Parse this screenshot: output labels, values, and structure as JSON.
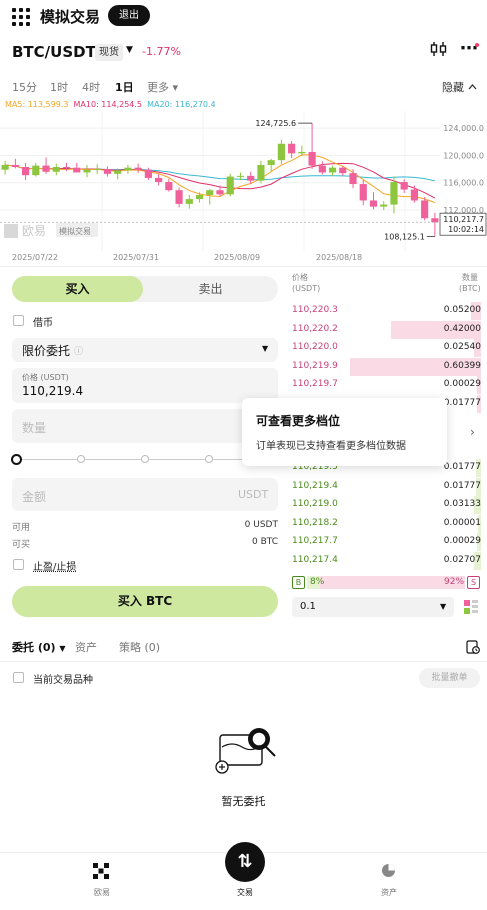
{
  "header": {
    "title": "模拟交易",
    "exit_label": "退出"
  },
  "ticker": {
    "pair": "BTC/USDT",
    "market_tag": "现货",
    "change": "-1.77%"
  },
  "timeframes": [
    {
      "label": "15分"
    },
    {
      "label": "1时"
    },
    {
      "label": "4时"
    },
    {
      "label": "1日",
      "active": true
    },
    {
      "label": "更多 ▾"
    }
  ],
  "hide_label": "隐藏",
  "ma": {
    "ma5": "MA5: 113,599.3",
    "ma10": "MA10: 114,254.5",
    "ma20": "MA20: 116,270.4",
    "ma5_color": "#f5a623",
    "ma10_color": "#e0306a",
    "ma20_color": "#3ab8d0"
  },
  "chart_data": {
    "type": "candlestick",
    "x": [
      "2025/07/22",
      "2025/07/31",
      "2025/08/09",
      "2025/08/18"
    ],
    "high_label": "124,725.6",
    "low_label": "108,125.1",
    "current_price": "110,217.7",
    "countdown": "10:02:14",
    "y_ticks": [
      "124,000.0",
      "120,000.0",
      "116,000.0",
      "112,000.0"
    ],
    "ylim": [
      106000,
      126500
    ],
    "watermark": "欧易",
    "watermark_tag": "模拟交易",
    "candles": [
      {
        "o": 117900,
        "h": 119200,
        "l": 117200,
        "c": 118600
      },
      {
        "o": 118600,
        "h": 119500,
        "l": 118100,
        "c": 118300
      },
      {
        "o": 118300,
        "h": 118900,
        "l": 116400,
        "c": 117100
      },
      {
        "o": 117100,
        "h": 118900,
        "l": 116900,
        "c": 118500
      },
      {
        "o": 118500,
        "h": 119700,
        "l": 117300,
        "c": 117600
      },
      {
        "o": 117600,
        "h": 118800,
        "l": 117100,
        "c": 118300
      },
      {
        "o": 118300,
        "h": 118900,
        "l": 117700,
        "c": 118200
      },
      {
        "o": 118200,
        "h": 118900,
        "l": 117500,
        "c": 117500
      },
      {
        "o": 117500,
        "h": 118600,
        "l": 116800,
        "c": 117900
      },
      {
        "o": 117900,
        "h": 118700,
        "l": 117300,
        "c": 118000
      },
      {
        "o": 118000,
        "h": 118400,
        "l": 116900,
        "c": 117300
      },
      {
        "o": 117300,
        "h": 118100,
        "l": 116500,
        "c": 117800
      },
      {
        "o": 117800,
        "h": 118600,
        "l": 117300,
        "c": 118200
      },
      {
        "o": 118200,
        "h": 118800,
        "l": 117400,
        "c": 117900
      },
      {
        "o": 117900,
        "h": 118200,
        "l": 116400,
        "c": 116700
      },
      {
        "o": 116700,
        "h": 117300,
        "l": 115600,
        "c": 116100
      },
      {
        "o": 116100,
        "h": 116600,
        "l": 114700,
        "c": 114900
      },
      {
        "o": 114900,
        "h": 115300,
        "l": 112400,
        "c": 112900
      },
      {
        "o": 112900,
        "h": 114200,
        "l": 112200,
        "c": 113600
      },
      {
        "o": 113600,
        "h": 114600,
        "l": 113100,
        "c": 114200
      },
      {
        "o": 114200,
        "h": 115100,
        "l": 112800,
        "c": 114900
      },
      {
        "o": 114900,
        "h": 115600,
        "l": 114000,
        "c": 114300
      },
      {
        "o": 114300,
        "h": 117300,
        "l": 114000,
        "c": 116900
      },
      {
        "o": 116900,
        "h": 117500,
        "l": 116400,
        "c": 117000
      },
      {
        "o": 117000,
        "h": 117600,
        "l": 115800,
        "c": 116300
      },
      {
        "o": 116300,
        "h": 119200,
        "l": 115900,
        "c": 118600
      },
      {
        "o": 118600,
        "h": 119500,
        "l": 117700,
        "c": 119300
      },
      {
        "o": 119300,
        "h": 122300,
        "l": 118700,
        "c": 121700
      },
      {
        "o": 121700,
        "h": 122100,
        "l": 119600,
        "c": 120300
      },
      {
        "o": 120300,
        "h": 121400,
        "l": 119900,
        "c": 120500
      },
      {
        "o": 120500,
        "h": 124725.6,
        "l": 118000,
        "c": 118500
      },
      {
        "o": 118500,
        "h": 119100,
        "l": 117200,
        "c": 117500
      },
      {
        "o": 117500,
        "h": 118500,
        "l": 117000,
        "c": 118200
      },
      {
        "o": 118200,
        "h": 118400,
        "l": 117000,
        "c": 117400
      },
      {
        "o": 117400,
        "h": 118000,
        "l": 115200,
        "c": 115800
      },
      {
        "o": 115800,
        "h": 116400,
        "l": 112700,
        "c": 113400
      },
      {
        "o": 113400,
        "h": 114600,
        "l": 112100,
        "c": 112500
      },
      {
        "o": 112500,
        "h": 113300,
        "l": 112000,
        "c": 112800
      },
      {
        "o": 112800,
        "h": 116900,
        "l": 111500,
        "c": 116100
      },
      {
        "o": 116100,
        "h": 116500,
        "l": 114500,
        "c": 115000
      },
      {
        "o": 115000,
        "h": 115600,
        "l": 113100,
        "c": 113400
      },
      {
        "o": 113400,
        "h": 113900,
        "l": 110500,
        "c": 110800
      },
      {
        "o": 110800,
        "h": 111600,
        "l": 108125.1,
        "c": 110217.7
      }
    ]
  },
  "order_form": {
    "buy_tab": "买入",
    "sell_tab": "卖出",
    "borrow_label": "借币",
    "order_type": "限价委托",
    "price_label": "价格 (USDT)",
    "price_value": "110,219.4",
    "qty_placeholder": "数量",
    "amount_placeholder": "金额",
    "amount_unit": "USDT",
    "available_label": "可用",
    "available_value": "0 USDT",
    "can_buy_label": "可买",
    "can_buy_value": "0 BTC",
    "tp_sl_label": "止盈/止损",
    "buy_button": "买入 BTC",
    "slider_percent": 0
  },
  "orderbook": {
    "price_head": "价格",
    "price_unit": "(USDT)",
    "qty_head": "数量",
    "qty_unit": "(BTC)",
    "asks": [
      {
        "price": "110,220.3",
        "qty": "0.05200",
        "depth": 0.08
      },
      {
        "price": "110,220.2",
        "qty": "0.42000",
        "depth": 0.69
      },
      {
        "price": "110,220.0",
        "qty": "0.02540",
        "depth": 0.05
      },
      {
        "price": "110,219.9",
        "qty": "0.60399",
        "depth": 1.0
      },
      {
        "price": "110,219.7",
        "qty": "0.00029",
        "depth": 0.03
      }
    ],
    "ask_partial": {
      "qty": "0.01777"
    },
    "bids": [
      {
        "price": "110,219.5",
        "qty": "0.01777",
        "depth": 0.04
      },
      {
        "price": "110,219.4",
        "qty": "0.01777",
        "depth": 0.04
      },
      {
        "price": "110,219.0",
        "qty": "0.03133",
        "depth": 0.05
      },
      {
        "price": "110,218.2",
        "qty": "0.00001",
        "depth": 0.02
      },
      {
        "price": "110,217.7",
        "qty": "0.00029",
        "depth": 0.03
      },
      {
        "price": "110,217.4",
        "qty": "0.02707",
        "depth": 0.05
      }
    ],
    "ratio_buy_label": "B",
    "ratio_buy": "8%",
    "ratio_sell": "92%",
    "ratio_sell_label": "S",
    "buy_fraction": 0.08,
    "depth_step": "0.1"
  },
  "tooltip": {
    "title": "可查看更多档位",
    "body": "订单表现已支持查看更多档位数据"
  },
  "orders": {
    "tab_orders": "委托 (0)",
    "tab_assets": "资产",
    "tab_strategy": "策略 (0)",
    "current_pair_label": "当前交易品种",
    "batch_cancel": "批量撤单",
    "empty_text": "暂无委托"
  },
  "nav": {
    "home": "欧易",
    "trade": "交易",
    "assets": "资产"
  },
  "colors": {
    "up": "#8cc63f",
    "down": "#f0609a",
    "buy_accent": "#cfe8a0",
    "ask_bg": "#fadbe5"
  }
}
